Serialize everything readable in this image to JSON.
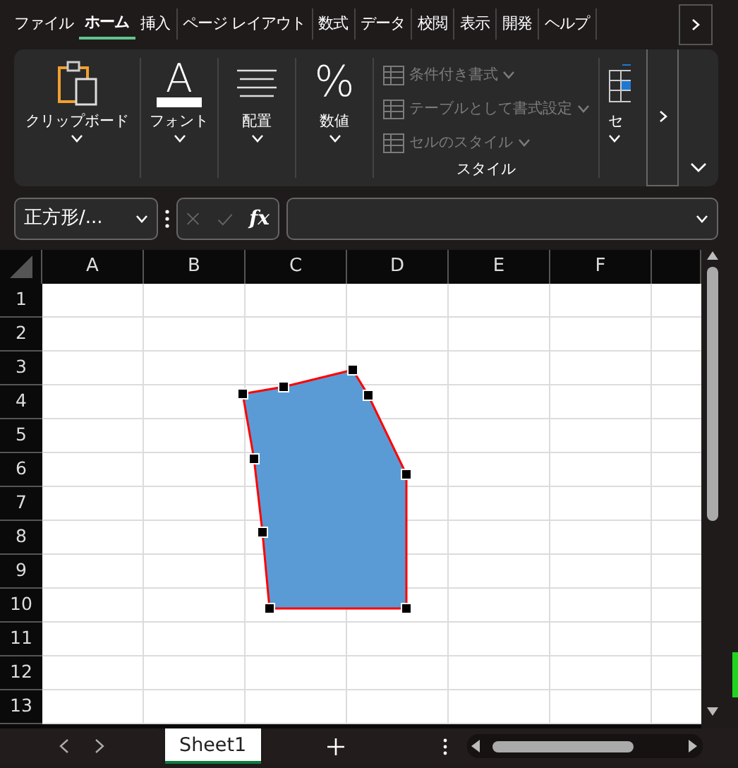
{
  "tabs": [
    {
      "label": "ファイル",
      "selected": false
    },
    {
      "label": "ホーム",
      "selected": true
    },
    {
      "label": "挿入",
      "selected": false
    },
    {
      "label": "ページ レイアウト",
      "selected": false
    },
    {
      "label": "数式",
      "selected": false
    },
    {
      "label": "データ",
      "selected": false
    },
    {
      "label": "校閲",
      "selected": false
    },
    {
      "label": "表示",
      "selected": false
    },
    {
      "label": "開発",
      "selected": false
    },
    {
      "label": "ヘルプ",
      "selected": false
    }
  ],
  "ribbon": {
    "groups": [
      {
        "kind": "clipboard",
        "label": "クリップボード"
      },
      {
        "kind": "font",
        "label": "フォント",
        "glyph": "A"
      },
      {
        "kind": "alignment",
        "label": "配置"
      },
      {
        "kind": "number",
        "label": "数値",
        "glyph": "%"
      },
      {
        "kind": "styles",
        "label": "スタイル",
        "items": [
          {
            "label": "条件付き書式",
            "disabled": true
          },
          {
            "label": "テーブルとして書式設定",
            "disabled": true
          },
          {
            "label": "セルのスタイル",
            "disabled": true
          }
        ]
      },
      {
        "kind": "cells",
        "label": "セ"
      }
    ]
  },
  "formula_bar": {
    "name_box": "正方形/...",
    "fx": "fx",
    "cancel_disabled": true
  },
  "sheet": {
    "columns": [
      "A",
      "B",
      "C",
      "D",
      "E",
      "F"
    ],
    "rows": [
      "1",
      "2",
      "3",
      "4",
      "5",
      "6",
      "7",
      "8",
      "9",
      "10",
      "11",
      "12",
      "13"
    ],
    "shape": {
      "kind": "freeform",
      "selected": true,
      "color": "#5b9bd5"
    }
  },
  "sheet_tabs": [
    {
      "label": "Sheet1",
      "selected": true
    }
  ]
}
